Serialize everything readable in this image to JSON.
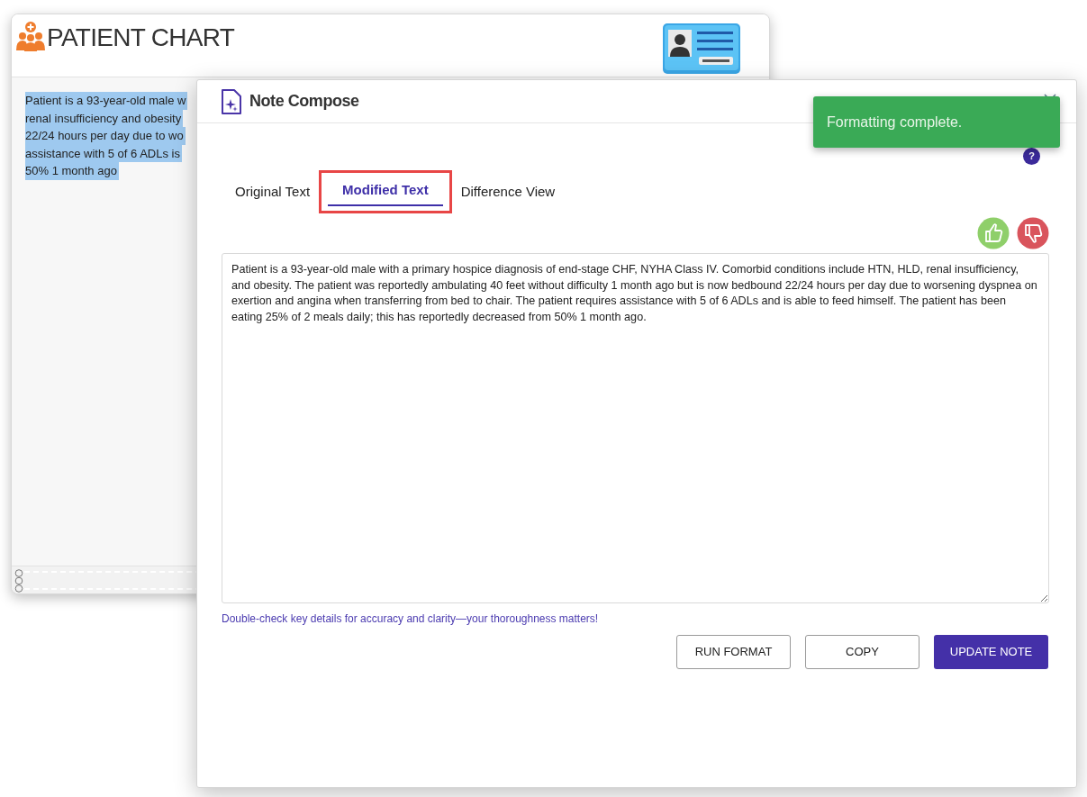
{
  "chart_window": {
    "title": "PATIENT CHART",
    "selected_text_lines": [
      "Patient is a 93-year-old male w",
      "renal insufficiency and obesity",
      "22/24 hours per day due to wo",
      "assistance with 5 of 6 ADLs is",
      "50% 1 month ago"
    ]
  },
  "modal": {
    "title": "Note Compose",
    "tabs": [
      {
        "label": "Original Text",
        "selected": false
      },
      {
        "label": "Modified Text",
        "selected": true
      },
      {
        "label": "Difference View",
        "selected": false
      }
    ],
    "note_text": "Patient is a 93-year-old male with a primary hospice diagnosis of end-stage CHF, NYHA Class IV. Comorbid conditions include HTN, HLD, renal insufficiency, and obesity. The patient was reportedly ambulating 40 feet without difficulty 1 month ago but is now bedbound 22/24 hours per day due to worsening dyspnea on exertion and angina when transferring from bed to chair. The patient requires assistance with 5 of 6 ADLs and is able to feed himself. The patient has been eating 25% of 2 meals daily; this has reportedly decreased from 50% 1 month ago.",
    "hint": "Double-check key details for accuracy and clarity—your thoroughness matters!",
    "help": "?",
    "buttons": [
      {
        "label": "RUN FORMAT",
        "kind": "outline"
      },
      {
        "label": "COPY",
        "kind": "outline"
      },
      {
        "label": "UPDATE NOTE",
        "kind": "primary"
      }
    ]
  },
  "toast": {
    "message": "Formatting complete."
  }
}
